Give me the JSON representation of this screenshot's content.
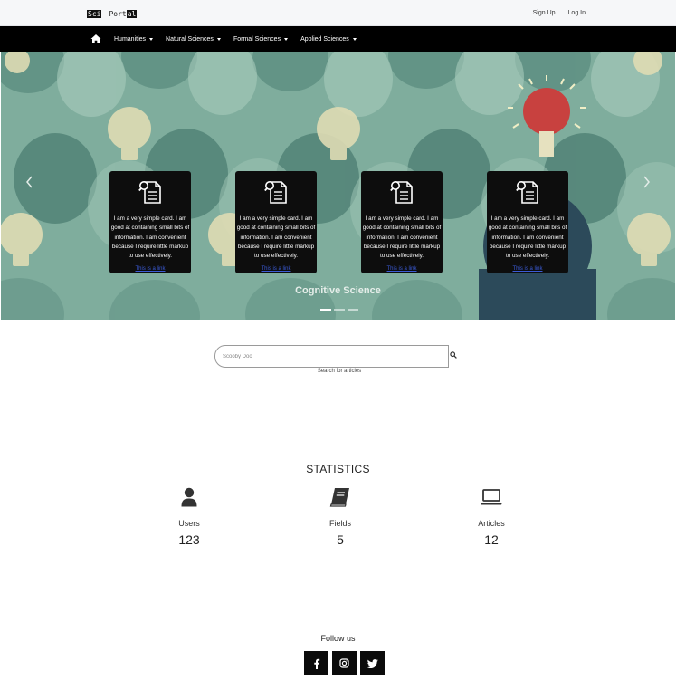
{
  "header": {
    "brand_left": "Sci",
    "brand_right_a": "Port",
    "brand_right_b": "al",
    "sign_up": "Sign Up",
    "log_in": "Log In"
  },
  "nav": {
    "home_icon": "home-icon",
    "items": [
      {
        "label": "Humanities"
      },
      {
        "label": "Natural Sciences"
      },
      {
        "label": "Formal Sciences"
      },
      {
        "label": "Applied Sciences"
      }
    ]
  },
  "carousel": {
    "caption": "Cognitive Science",
    "prev_icon": "chevron-left-icon",
    "next_icon": "chevron-right-icon",
    "cards": [
      {
        "text": "I am a very simple card. I am good at containing small bits of information. I am convenient because I require little markup to use effectively.",
        "link": "This is a link",
        "icon": "document-search-icon"
      },
      {
        "text": "I am a very simple card. I am good at containing small bits of information. I am convenient because I require little markup to use effectively.",
        "link": "This is a link",
        "icon": "document-search-icon"
      },
      {
        "text": "I am a very simple card. I am good at containing small bits of information. I am convenient because I require little markup to use effectively.",
        "link": "This is a link",
        "icon": "document-search-icon"
      },
      {
        "text": "I am a very simple card. I am good at containing small bits of information. I am convenient because I require little markup to use effectively.",
        "link": "This is a link",
        "icon": "document-search-icon"
      }
    ],
    "active_slide": 1,
    "slide_count": 3
  },
  "search": {
    "placeholder": "Scooby Doo",
    "help": "Search for articles",
    "icon": "search-icon"
  },
  "statistics": {
    "title": "STATISTICS",
    "items": [
      {
        "label": "Users",
        "value": "123",
        "icon": "user-icon"
      },
      {
        "label": "Fields",
        "value": "5",
        "icon": "book-icon"
      },
      {
        "label": "Articles",
        "value": "12",
        "icon": "laptop-icon"
      }
    ]
  },
  "footer": {
    "follow": "Follow us",
    "social": [
      {
        "icon": "facebook-icon"
      },
      {
        "icon": "instagram-icon"
      },
      {
        "icon": "twitter-icon"
      }
    ]
  },
  "colors": {
    "nav_bg": "#000000",
    "topbar_bg": "#f6f7f9",
    "card_bg": "#0d0d0d",
    "link": "#3b5bd6",
    "hero_bg": "#79a79a",
    "bulb_red": "#c8413f"
  }
}
